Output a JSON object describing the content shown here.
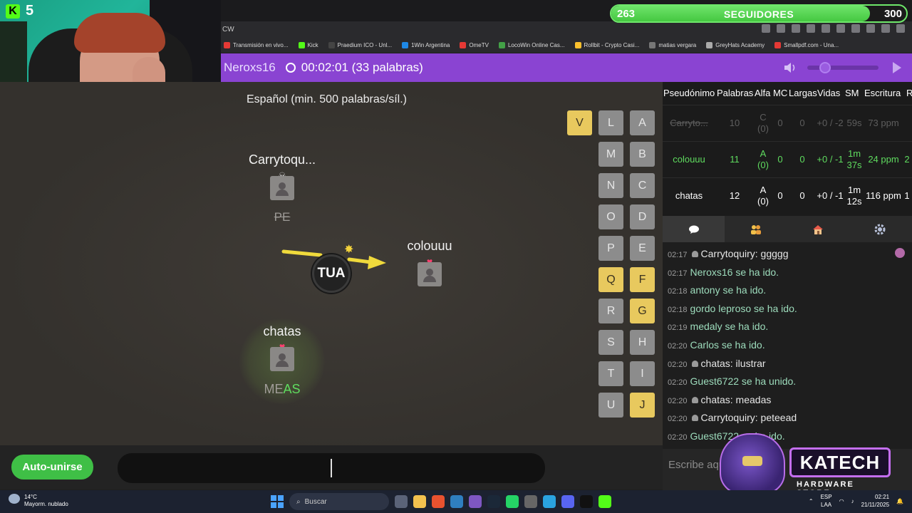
{
  "overlay": {
    "kick_count": "5",
    "followers_current": "263",
    "followers_label": "SEGUIDORES",
    "followers_goal": "300",
    "followers_progress": 0.877
  },
  "browser": {
    "url": "CW",
    "bookmarks": [
      {
        "label": "Transmisión en vivo...",
        "color": "#e53935"
      },
      {
        "label": "Kick",
        "color": "#53fc18"
      },
      {
        "label": "Praedium ICO - Unl...",
        "color": "#444"
      },
      {
        "label": "1Win Argentina",
        "color": "#1e88e5"
      },
      {
        "label": "OmeTV",
        "color": "#e53935"
      },
      {
        "label": "LocoWin Online Cas...",
        "color": "#43a047"
      },
      {
        "label": "Rollbit - Crypto Casi...",
        "color": "#fbc02d"
      },
      {
        "label": "matias vergara",
        "color": "#777"
      },
      {
        "label": "GreyHats Academy",
        "color": "#aaa"
      },
      {
        "label": "Smallpdf.com - Una...",
        "color": "#e53935"
      }
    ]
  },
  "game": {
    "username": "Neroxs16",
    "timer": "00:02:01 (33 palabras)",
    "language_rule": "Español (min. 500 palabras/síl.)",
    "prompt": "TUA",
    "players": [
      {
        "name": "Carrytoqu...",
        "word": "PE",
        "status": "dead"
      },
      {
        "name": "colouuu",
        "word": "",
        "status": "alive"
      },
      {
        "name": "chatas",
        "word_typed": "ME",
        "word_match": "AS",
        "status": "alive"
      }
    ],
    "letters": [
      {
        "l": "V",
        "used": true
      },
      {
        "l": "L",
        "used": false
      },
      {
        "l": "A",
        "used": false
      },
      {
        "l": "M",
        "used": false
      },
      {
        "l": "B",
        "used": false
      },
      {
        "l": "N",
        "used": false
      },
      {
        "l": "C",
        "used": false
      },
      {
        "l": "O",
        "used": false
      },
      {
        "l": "D",
        "used": false
      },
      {
        "l": "P",
        "used": false
      },
      {
        "l": "E",
        "used": false
      },
      {
        "l": "Q",
        "used": true
      },
      {
        "l": "F",
        "used": true
      },
      {
        "l": "R",
        "used": false
      },
      {
        "l": "G",
        "used": true
      },
      {
        "l": "S",
        "used": false
      },
      {
        "l": "H",
        "used": false
      },
      {
        "l": "T",
        "used": false
      },
      {
        "l": "I",
        "used": false
      },
      {
        "l": "U",
        "used": false
      },
      {
        "l": "J",
        "used": true
      }
    ],
    "auto_join_label": "Auto-unirse",
    "volume_level": 0.25
  },
  "stats": {
    "headers": [
      "Pseudónimo",
      "Palabras",
      "Alfa",
      "MC",
      "Largas",
      "Vidas",
      "SM",
      "Escritura",
      "R"
    ],
    "rows": [
      {
        "name": "Carryto...",
        "palabras": "10",
        "alfa": "C (0)",
        "mc": "0",
        "largas": "0",
        "vidas": "+0 / -2",
        "sm": "59s",
        "escritura": "73 ppm",
        "r": "",
        "state": "dead"
      },
      {
        "name": "colouuu",
        "palabras": "11",
        "alfa": "A (0)",
        "mc": "0",
        "largas": "0",
        "vidas": "+0 / -1",
        "sm": "1m 37s",
        "escritura": "24 ppm",
        "r": "2",
        "state": "me"
      },
      {
        "name": "chatas",
        "palabras": "12",
        "alfa": "A (0)",
        "mc": "0",
        "largas": "0",
        "vidas": "+0 / -1",
        "sm": "1m 12s",
        "escritura": "116 ppm",
        "r": "1",
        "state": "alive"
      }
    ]
  },
  "chat": {
    "messages": [
      {
        "time": "02:17",
        "user": "Carrytoquiry",
        "text": ": ggggg",
        "system": false
      },
      {
        "time": "02:17",
        "user": "",
        "text": "Neroxs16 se ha ido.",
        "system": true
      },
      {
        "time": "02:18",
        "user": "",
        "text": "antony se ha ido.",
        "system": true
      },
      {
        "time": "02:18",
        "user": "",
        "text": "gordo leproso se ha ido.",
        "system": true
      },
      {
        "time": "02:19",
        "user": "",
        "text": "medaly se ha ido.",
        "system": true
      },
      {
        "time": "02:20",
        "user": "",
        "text": "Carlos  se ha ido.",
        "system": true
      },
      {
        "time": "02:20",
        "user": "chatas",
        "text": ": ilustrar",
        "system": false
      },
      {
        "time": "02:20",
        "user": "",
        "text": "Guest6722 se ha unido.",
        "system": true
      },
      {
        "time": "02:20",
        "user": "chatas",
        "text": ": meadas",
        "system": false
      },
      {
        "time": "02:20",
        "user": "Carrytoquiry",
        "text": ": peteead",
        "system": false
      },
      {
        "time": "02:20",
        "user": "",
        "text": "Guest6722 se ha ido.",
        "system": true
      }
    ],
    "placeholder": "Escribe aquí"
  },
  "brand": {
    "name": "KATECH",
    "subtitle": "HARDWARE STORE"
  },
  "taskbar": {
    "temp": "14°C",
    "weather": "Mayorm. nublado",
    "search": "Buscar",
    "lang_1": "ESP",
    "lang_2": "LAA",
    "time": "02:21",
    "date": "21/11/2025"
  }
}
